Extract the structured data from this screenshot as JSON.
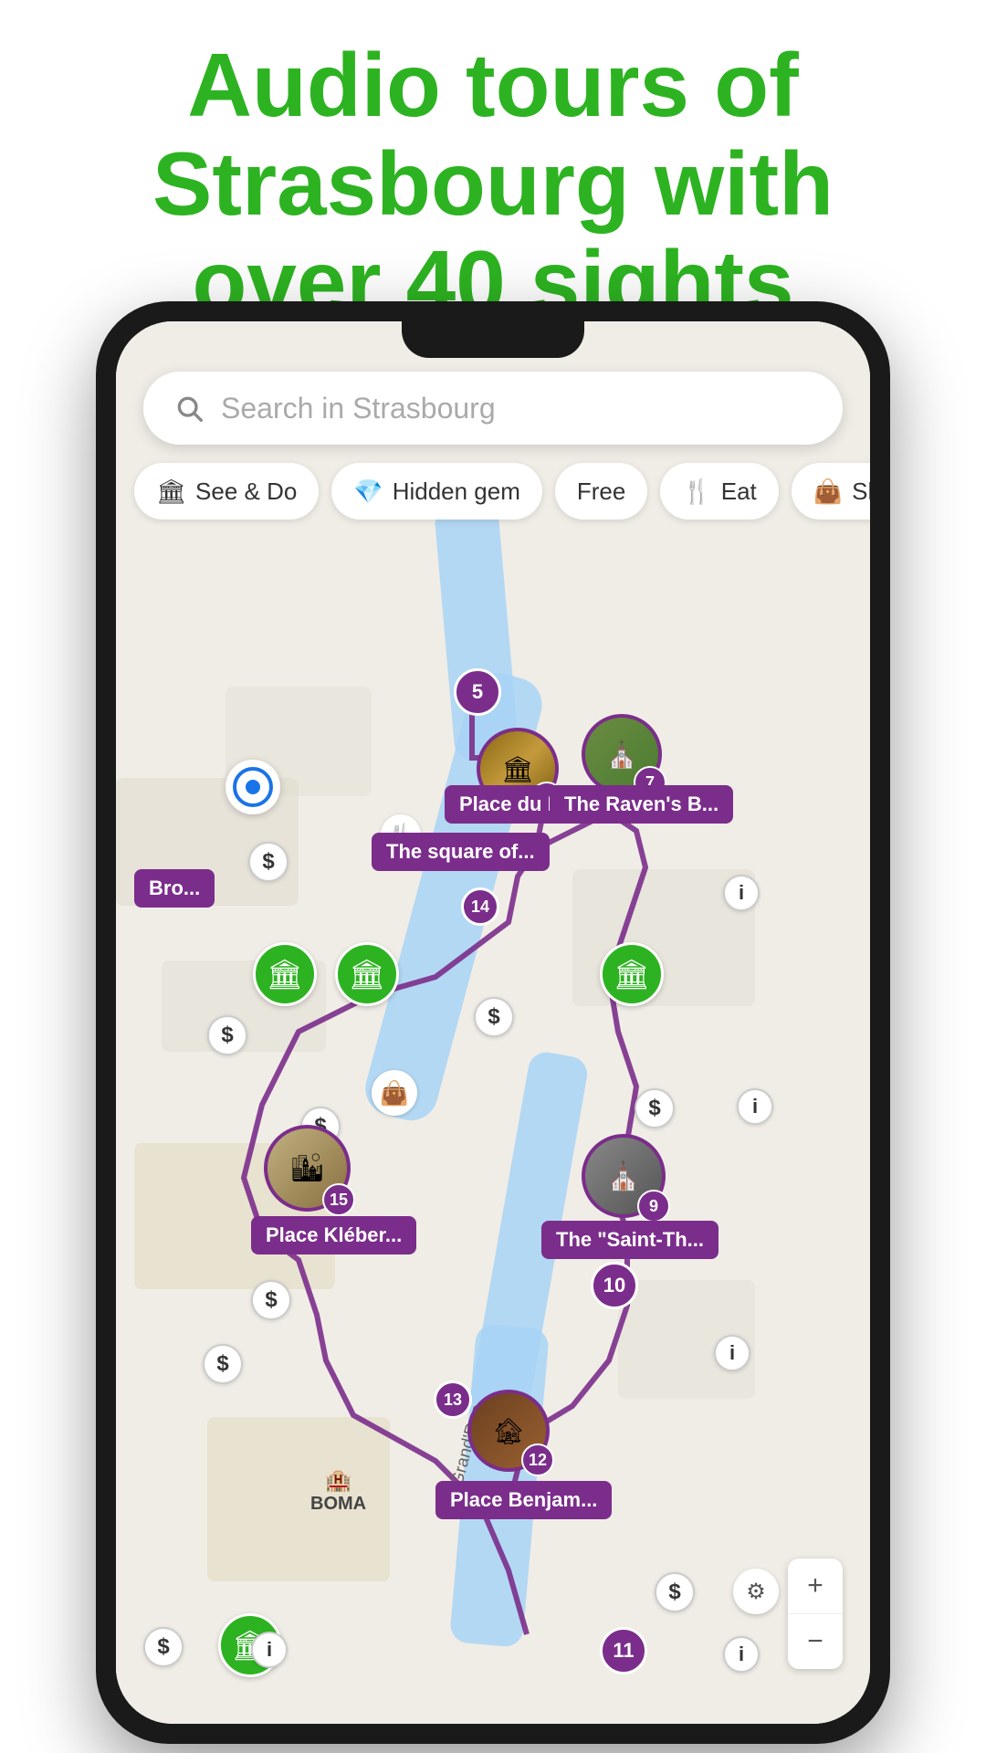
{
  "header": {
    "title": "Audio tours of Strasbourg with over 40 sights",
    "accent_color": "#2db321"
  },
  "search": {
    "placeholder": "Search in Strasbourg",
    "icon": "search"
  },
  "filters": [
    {
      "id": "see-do",
      "label": "See & Do",
      "icon": "🏛",
      "active": false
    },
    {
      "id": "hidden-gem",
      "label": "Hidden gem",
      "icon": "💎",
      "active": false
    },
    {
      "id": "free",
      "label": "Free",
      "icon": "",
      "active": false
    },
    {
      "id": "eat",
      "label": "Eat",
      "icon": "🍴",
      "active": false
    },
    {
      "id": "shop",
      "label": "Sh...",
      "icon": "👜",
      "active": false
    }
  ],
  "map": {
    "markers": [
      {
        "id": 5,
        "type": "number",
        "label": "5"
      },
      {
        "id": 6,
        "type": "photo",
        "label": "6"
      },
      {
        "id": 7,
        "type": "photo",
        "label": "7"
      },
      {
        "id": 9,
        "type": "photo",
        "label": "9"
      },
      {
        "id": 10,
        "type": "number",
        "label": "10"
      },
      {
        "id": 11,
        "type": "number",
        "label": "11"
      },
      {
        "id": 12,
        "type": "photo",
        "label": "12"
      },
      {
        "id": 13,
        "type": "number",
        "label": "13"
      },
      {
        "id": 14,
        "type": "number",
        "label": "14"
      },
      {
        "id": 15,
        "type": "photo",
        "label": "15"
      }
    ],
    "tooltips": [
      {
        "id": "place-du-mar",
        "text": "Place du Mar..."
      },
      {
        "id": "the-square-of",
        "text": "The square of..."
      },
      {
        "id": "the-ravens-b",
        "text": "The Raven's B..."
      },
      {
        "id": "place-kleber",
        "text": "Place Kléber..."
      },
      {
        "id": "saint-th",
        "text": "The \"Saint-Th..."
      },
      {
        "id": "place-benjam",
        "text": "Place Benjam..."
      },
      {
        "id": "bro",
        "text": "Bro..."
      }
    ],
    "street_labels": [
      "Grand'Rue"
    ],
    "poi_labels": [
      "BOMA"
    ]
  }
}
